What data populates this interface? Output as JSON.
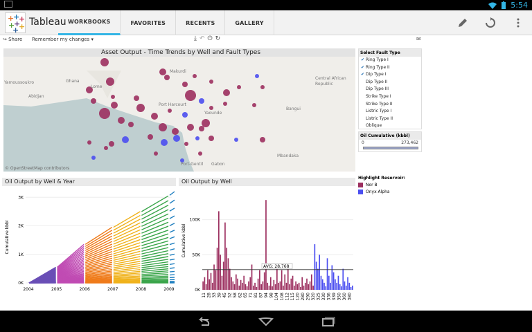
{
  "statusbar": {
    "time": "5:54"
  },
  "app": {
    "title": "Tableau"
  },
  "tabs": [
    {
      "label": "WORKBOOKS"
    },
    {
      "label": "FAVORITES"
    },
    {
      "label": "RECENTS"
    },
    {
      "label": "GALLERY"
    }
  ],
  "actions": {
    "edit": "pencil-icon",
    "refresh": "refresh-icon",
    "menu": "overflow-menu-icon"
  },
  "toolbar": {
    "share": "Share",
    "remember": "Remember my changes"
  },
  "map": {
    "title": "Asset Output - Time Trends by Well and Fault Types",
    "copyright": "© OpenStreetMap contributors",
    "labels": [
      "Yamoussoukro",
      "Abidjan",
      "Ghana",
      "Lome",
      "Makurdi",
      "Port Harcourt",
      "Yaounde",
      "Bangui",
      "Central African Republic",
      "Gabon",
      "Port-Gentil",
      "Mbandaka"
    ]
  },
  "filters": {
    "title": "Select Fault Type",
    "items": [
      {
        "label": "Ring Type I",
        "checked": true
      },
      {
        "label": "Ring Type II",
        "checked": true
      },
      {
        "label": "Dip Type I",
        "checked": true
      },
      {
        "label": "Dip Type II",
        "checked": false
      },
      {
        "label": "Dip Type III",
        "checked": false
      },
      {
        "label": "Strike Type I",
        "checked": false
      },
      {
        "label": "Strike Type II",
        "checked": false
      },
      {
        "label": "Listric Type I",
        "checked": false
      },
      {
        "label": "Listric Type II",
        "checked": false
      },
      {
        "label": "Oblique",
        "checked": false
      }
    ]
  },
  "oil_filter": {
    "title": "Oil Cumulative (kbbl)",
    "min": "0",
    "max": "273,462"
  },
  "highlight": {
    "title": "Highlight Reservoir:",
    "items": [
      {
        "label": "Nor B",
        "color": "#9c2f5f"
      },
      {
        "label": "Onyx Alpha",
        "color": "#4b4ef0"
      }
    ]
  },
  "chart_data": [
    {
      "type": "line",
      "title": "Oil Output by Well & Year",
      "ylabel": "Cumulative kbbl",
      "x_ticks": [
        "2004",
        "2005",
        "2006",
        "2007",
        "2008",
        "2009"
      ],
      "y_ticks": [
        "0K",
        "1K",
        "2K",
        "3K"
      ],
      "ylim": [
        0,
        3200
      ],
      "series_colors": [
        "#6a4fb6",
        "#c04bb3",
        "#ef7b1a",
        "#f0b21b",
        "#3aa54a",
        "#1f7fc0"
      ],
      "top_envelope": [
        0,
        550,
        1350,
        1950,
        2500,
        3050
      ]
    },
    {
      "type": "bar",
      "title": "Oil Output by Well",
      "ylabel": "Cumulative kbbl",
      "y_ticks": [
        "0K",
        "50K",
        "100K"
      ],
      "ylim": [
        0,
        140000
      ],
      "average": {
        "label": "AVG: 28,768",
        "value": 28768
      },
      "x_tick_labels": [
        "11",
        "28",
        "33",
        "39",
        "45",
        "52",
        "58",
        "62",
        "65",
        "71",
        "81",
        "87",
        "94",
        "98",
        "104",
        "108",
        "112",
        "115",
        "120",
        "280",
        "290",
        "320",
        "325",
        "330",
        "336",
        "339",
        "350",
        "360",
        "380"
      ],
      "nor_b_values": [
        12000,
        18000,
        8000,
        28000,
        15000,
        24000,
        10000,
        36000,
        28000,
        60000,
        112000,
        50000,
        20000,
        40000,
        96000,
        60000,
        45000,
        30000,
        18000,
        12000,
        8000,
        22000,
        16000,
        6000,
        14000,
        10000,
        20000,
        8000,
        5000,
        12000,
        18000,
        36000,
        6000,
        10000,
        4000,
        16000,
        28000,
        8000,
        12000,
        25000,
        128000,
        10000,
        6000,
        18000,
        5000,
        14000,
        8000,
        36000,
        10000,
        12000,
        28000,
        6000,
        22000,
        10000,
        30000,
        8000,
        16000,
        20000,
        6000,
        12000,
        8000,
        10000,
        4000,
        18000,
        6000,
        10000,
        16000,
        8000,
        12000,
        22000,
        6000
      ],
      "onyx_values": [
        65000,
        40000,
        30000,
        50000,
        20000,
        15000,
        10000,
        5000,
        45000,
        20000,
        10000,
        35000,
        25000,
        15000,
        10000,
        20000,
        8000,
        5000,
        30000,
        12000,
        6000,
        18000,
        10000,
        4000,
        6000
      ]
    }
  ]
}
